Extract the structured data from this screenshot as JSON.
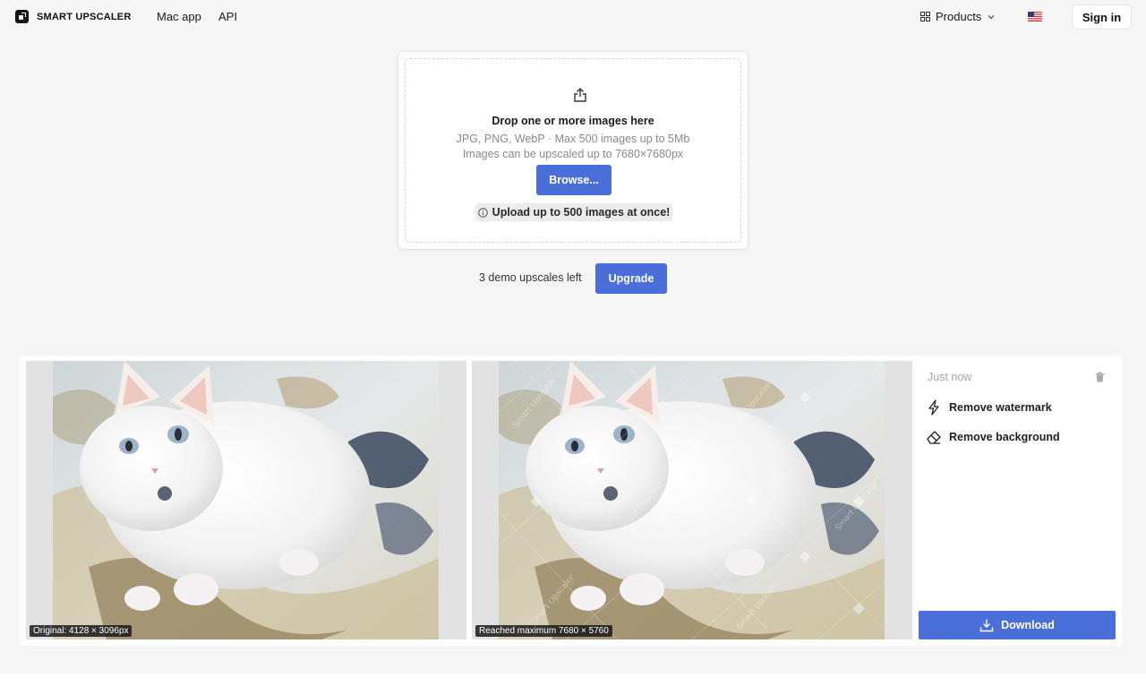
{
  "header": {
    "logo_text": "SMART UPSCALER",
    "nav": {
      "mac_app": "Mac app",
      "api": "API"
    },
    "products_label": "Products",
    "signin_label": "Sign in"
  },
  "upload": {
    "title": "Drop one or more images here",
    "subtitle_formats": "JPG, PNG, WebP · Max 500 images up to 5Mb",
    "subtitle_size": "Images can be upscaled up to 7680×7680px",
    "browse_label": "Browse...",
    "note": "Upload up to 500 images at once!"
  },
  "demo": {
    "remaining_text": "3 demo upscales left",
    "upgrade_label": "Upgrade"
  },
  "result": {
    "original_label": "Original: 4128 × 3096px",
    "upscaled_label": "Reached maximum 7680 × 5760",
    "timestamp": "Just now",
    "actions": {
      "remove_watermark": "Remove watermark",
      "remove_background": "Remove background"
    },
    "download_label": "Download",
    "watermark_text": "Smart Upscaler"
  },
  "colors": {
    "accent": "#4a6fd8",
    "background": "#f6f6f6",
    "card": "#ffffff"
  },
  "icons": [
    "logo-icon",
    "grid-icon",
    "chevron-down-icon",
    "us-flag-icon",
    "upload-icon",
    "info-icon",
    "trash-icon",
    "lightning-icon",
    "eraser-icon",
    "download-icon"
  ]
}
